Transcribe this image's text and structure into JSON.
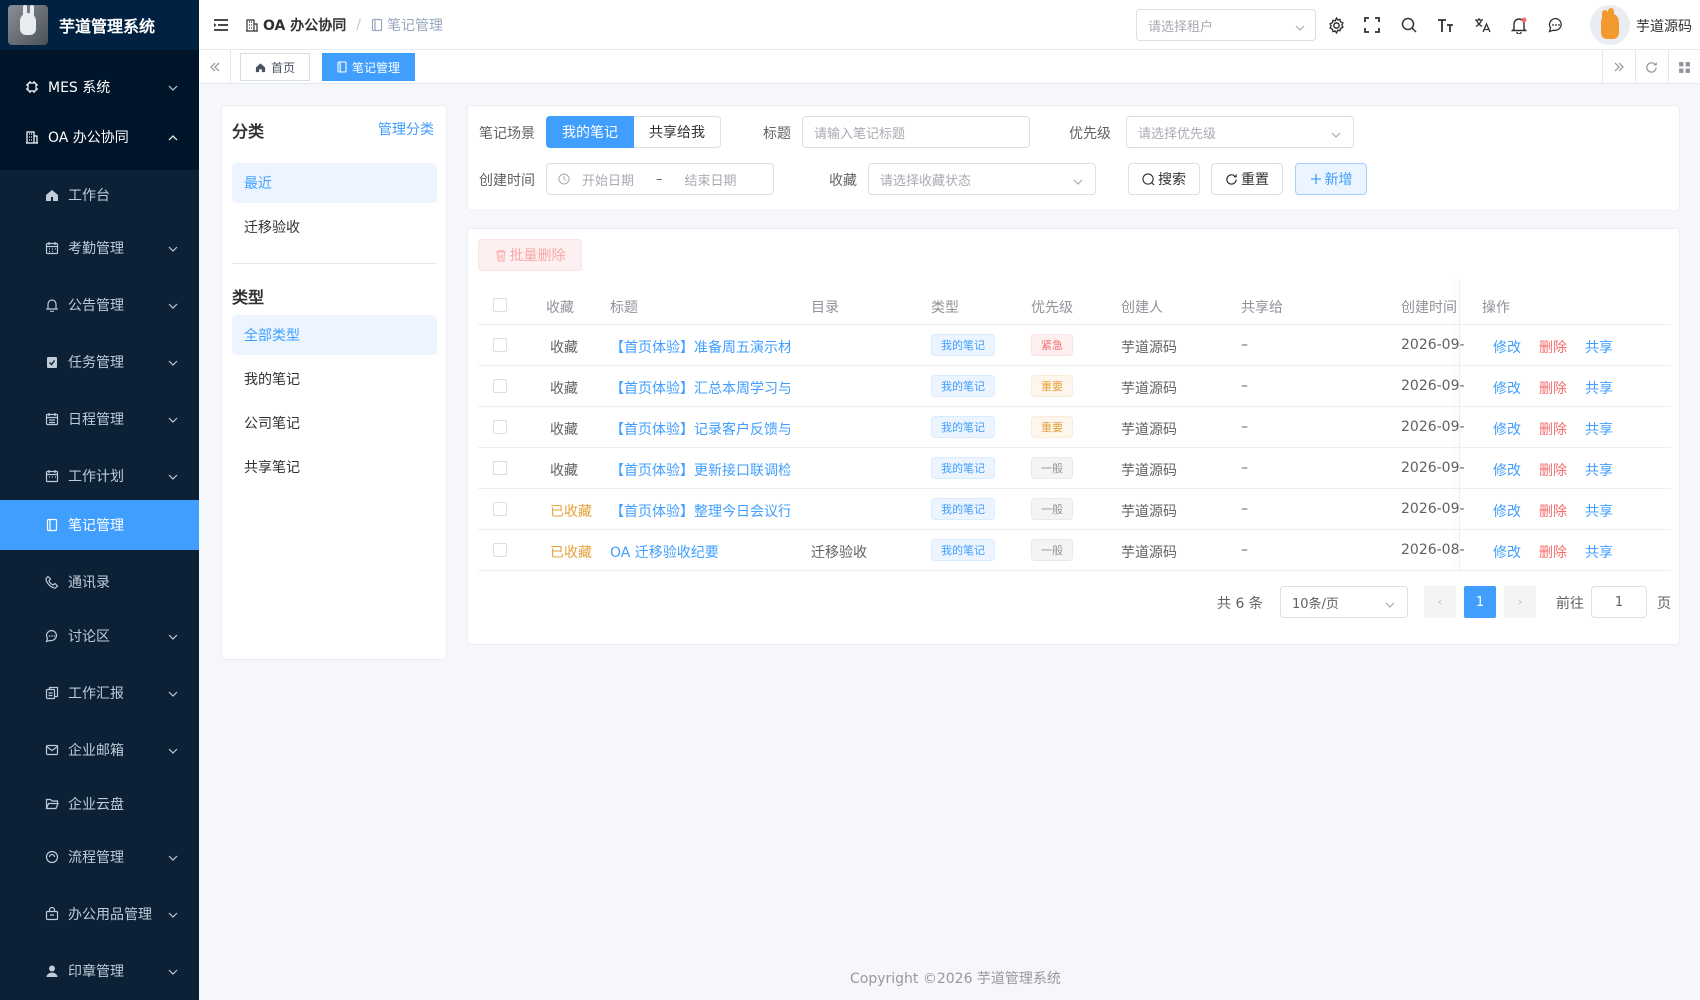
{
  "app": {
    "title": "芋道管理系统"
  },
  "sidebar": {
    "items": [
      {
        "label": "MES 系统"
      },
      {
        "label": "OA 办公协同"
      },
      {
        "label": "工作台"
      },
      {
        "label": "考勤管理"
      },
      {
        "label": "公告管理"
      },
      {
        "label": "任务管理"
      },
      {
        "label": "日程管理"
      },
      {
        "label": "工作计划"
      },
      {
        "label": "笔记管理"
      },
      {
        "label": "通讯录"
      },
      {
        "label": "讨论区"
      },
      {
        "label": "工作汇报"
      },
      {
        "label": "企业邮箱"
      },
      {
        "label": "企业云盘"
      },
      {
        "label": "流程管理"
      },
      {
        "label": "办公用品管理"
      },
      {
        "label": "印章管理"
      }
    ]
  },
  "header": {
    "breadcrumb": [
      "OA 办公协同",
      "笔记管理"
    ],
    "tenant_placeholder": "请选择租户",
    "username": "芋道源码"
  },
  "tags": [
    {
      "label": "首页"
    },
    {
      "label": "笔记管理"
    }
  ],
  "category": {
    "title1": "分类",
    "manage": "管理分类",
    "group1": [
      "最近",
      "迁移验收"
    ],
    "title2": "类型",
    "group2": [
      "全部类型",
      "我的笔记",
      "公司笔记",
      "共享笔记"
    ]
  },
  "search": {
    "scene_label": "笔记场景",
    "scene_options": [
      "我的笔记",
      "共享给我"
    ],
    "title_label": "标题",
    "title_placeholder": "请输入笔记标题",
    "priority_label": "优先级",
    "priority_placeholder": "请选择优先级",
    "created_label": "创建时间",
    "start_placeholder": "开始日期",
    "range_sep": "–",
    "end_placeholder": "结束日期",
    "fav_label": "收藏",
    "fav_placeholder": "请选择收藏状态",
    "search_btn": "搜索",
    "reset_btn": "重置",
    "add_btn": "新增"
  },
  "table": {
    "batch_delete": "批量删除",
    "headers": [
      "收藏",
      "标题",
      "目录",
      "类型",
      "优先级",
      "创建人",
      "共享给",
      "创建时间",
      "操作"
    ],
    "rows": [
      {
        "fav": "收藏",
        "fav_done": false,
        "title": "【首页体验】准备周五演示材",
        "dir": "",
        "type": "我的笔记",
        "priority": "紧急",
        "level": "danger",
        "creator": "芋道源码",
        "share": "–",
        "created": "2026-09-"
      },
      {
        "fav": "收藏",
        "fav_done": false,
        "title": "【首页体验】汇总本周学习与",
        "dir": "",
        "type": "我的笔记",
        "priority": "重要",
        "level": "warning",
        "creator": "芋道源码",
        "share": "–",
        "created": "2026-09-"
      },
      {
        "fav": "收藏",
        "fav_done": false,
        "title": "【首页体验】记录客户反馈与",
        "dir": "",
        "type": "我的笔记",
        "priority": "重要",
        "level": "warning",
        "creator": "芋道源码",
        "share": "–",
        "created": "2026-09-"
      },
      {
        "fav": "收藏",
        "fav_done": false,
        "title": "【首页体验】更新接口联调检",
        "dir": "",
        "type": "我的笔记",
        "priority": "一般",
        "level": "info",
        "creator": "芋道源码",
        "share": "–",
        "created": "2026-09-"
      },
      {
        "fav": "已收藏",
        "fav_done": true,
        "title": "【首页体验】整理今日会议行",
        "dir": "",
        "type": "我的笔记",
        "priority": "一般",
        "level": "info",
        "creator": "芋道源码",
        "share": "–",
        "created": "2026-09-"
      },
      {
        "fav": "已收藏",
        "fav_done": true,
        "title": "OA 迁移验收纪要",
        "dir": "迁移验收",
        "type": "我的笔记",
        "priority": "一般",
        "level": "info",
        "creator": "芋道源码",
        "share": "–",
        "created": "2026-08-"
      }
    ],
    "ops": [
      "修改",
      "删除",
      "共享"
    ]
  },
  "pagination": {
    "total": "共 6 条",
    "page_size": "10条/页",
    "current": "1",
    "goto_label": "前往",
    "goto_value": "1",
    "page_suffix": "页"
  },
  "footer": "Copyright ©2026 芋道管理系统",
  "colors": {
    "primary": "#409eff",
    "sidebar": "#001529",
    "danger": "#f56c6c",
    "warning": "#e6a23c"
  }
}
